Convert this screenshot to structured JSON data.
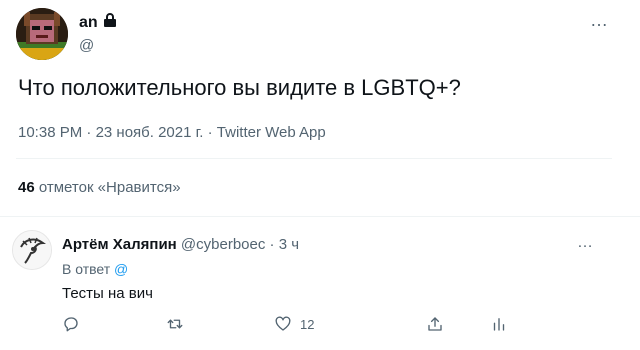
{
  "tweet": {
    "author_name": "an",
    "author_handle": "@",
    "text": "Что положительного вы видите в LGBTQ+?",
    "time": "10:38 PM",
    "date": "23 нояб. 2021 г.",
    "source": "Twitter Web App",
    "separator": " · ",
    "likes_count": "46",
    "likes_label": "отметок «Нравится»",
    "more_icon": "…"
  },
  "reply": {
    "author_name": "Артём Халяпин",
    "author_handle": "@cyberboec",
    "time_ago": "3 ч",
    "separator": " · ",
    "reply_to_label": "В ответ",
    "reply_to_handle": "@",
    "text": "Тесты на вич",
    "more_icon": "…",
    "actions": {
      "reply_count": "",
      "retweet_count": "",
      "like_count": "12"
    }
  },
  "colors": {
    "accent": "#1d9bf0",
    "text": "#0f1419",
    "secondary": "#536471",
    "divider": "#eff3f4"
  },
  "icons": [
    "lock-icon",
    "more-icon",
    "reply-icon",
    "retweet-icon",
    "like-icon",
    "share-icon",
    "analytics-icon"
  ]
}
